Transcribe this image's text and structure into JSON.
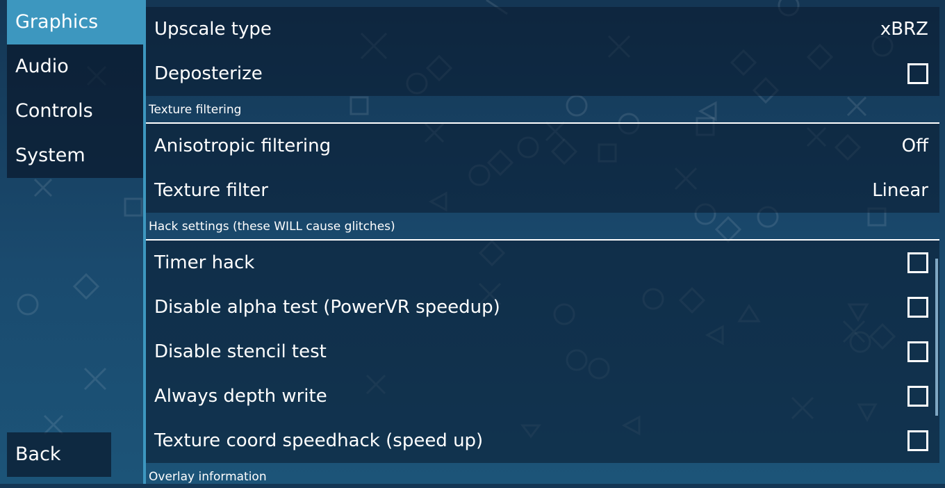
{
  "sidebar": {
    "tabs": [
      {
        "label": "Graphics",
        "active": true
      },
      {
        "label": "Audio"
      },
      {
        "label": "Controls"
      },
      {
        "label": "System"
      }
    ],
    "back_label": "Back"
  },
  "content": {
    "upscale_type": {
      "label": "Upscale type",
      "value": "xBRZ"
    },
    "deposterize": {
      "label": "Deposterize",
      "checked": false
    },
    "texture_filtering_header": "Texture filtering",
    "anisotropic": {
      "label": "Anisotropic filtering",
      "value": "Off"
    },
    "texture_filter": {
      "label": "Texture filter",
      "value": "Linear"
    },
    "hack_header": "Hack settings (these WILL cause glitches)",
    "hacks": [
      {
        "label": "Timer hack",
        "checked": false
      },
      {
        "label": "Disable alpha test (PowerVR speedup)",
        "checked": false
      },
      {
        "label": "Disable stencil test",
        "checked": false
      },
      {
        "label": "Always depth write",
        "checked": false
      },
      {
        "label": "Texture coord speedhack (speed up)",
        "checked": false
      }
    ],
    "overlay_header": "Overlay information"
  },
  "theme": {
    "accent": "#3d97bf",
    "background": "#1a4a6e"
  }
}
